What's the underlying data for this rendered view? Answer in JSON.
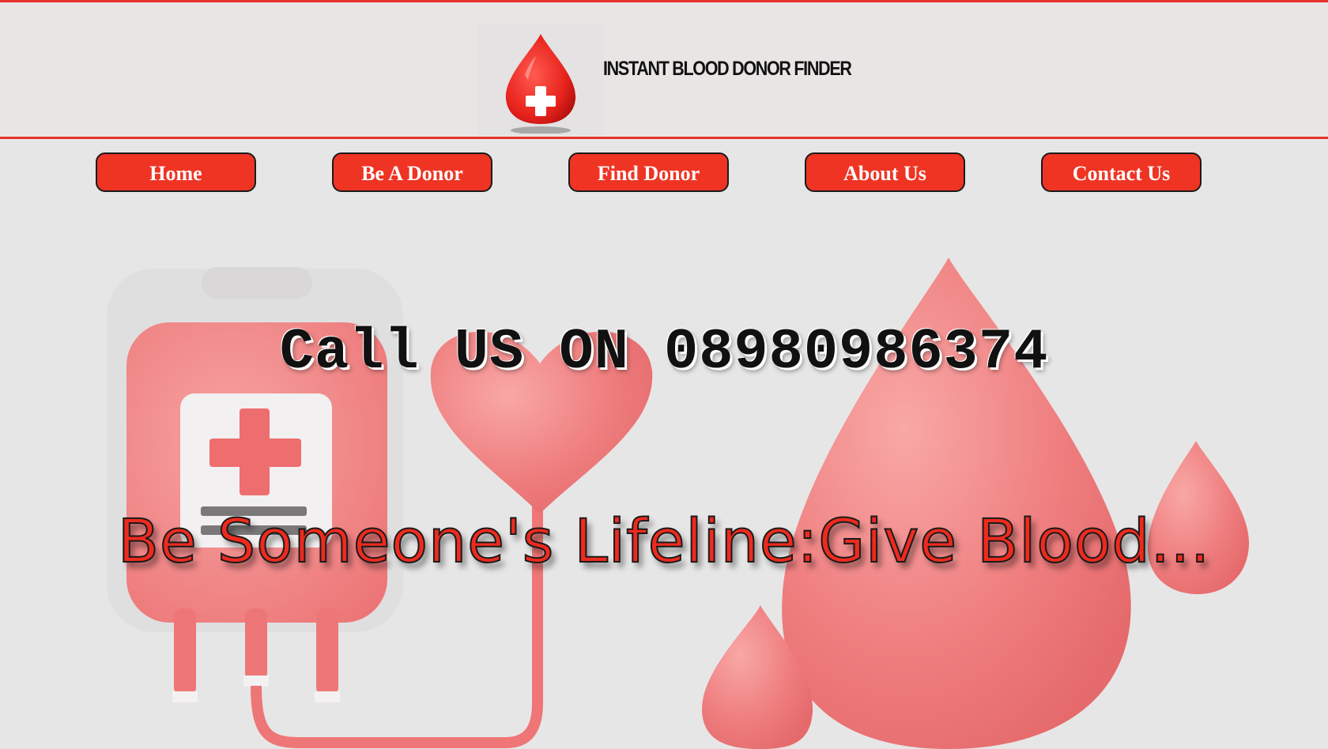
{
  "header": {
    "site_title": "INSTANT BLOOD DONOR FINDER"
  },
  "nav": {
    "items": [
      {
        "label": "Home"
      },
      {
        "label": "Be A Donor"
      },
      {
        "label": "Find Donor"
      },
      {
        "label": "About Us"
      },
      {
        "label": "Contact Us"
      }
    ]
  },
  "hero": {
    "call_text": "Call US ON 08980986374",
    "tagline": "Be Someone's Lifeline:Give Blood..."
  },
  "colors": {
    "brand_red": "#ef3424",
    "accent_border": "#e8322a",
    "background": "#e7e6e6",
    "illustration_pink": "#f07f80"
  }
}
